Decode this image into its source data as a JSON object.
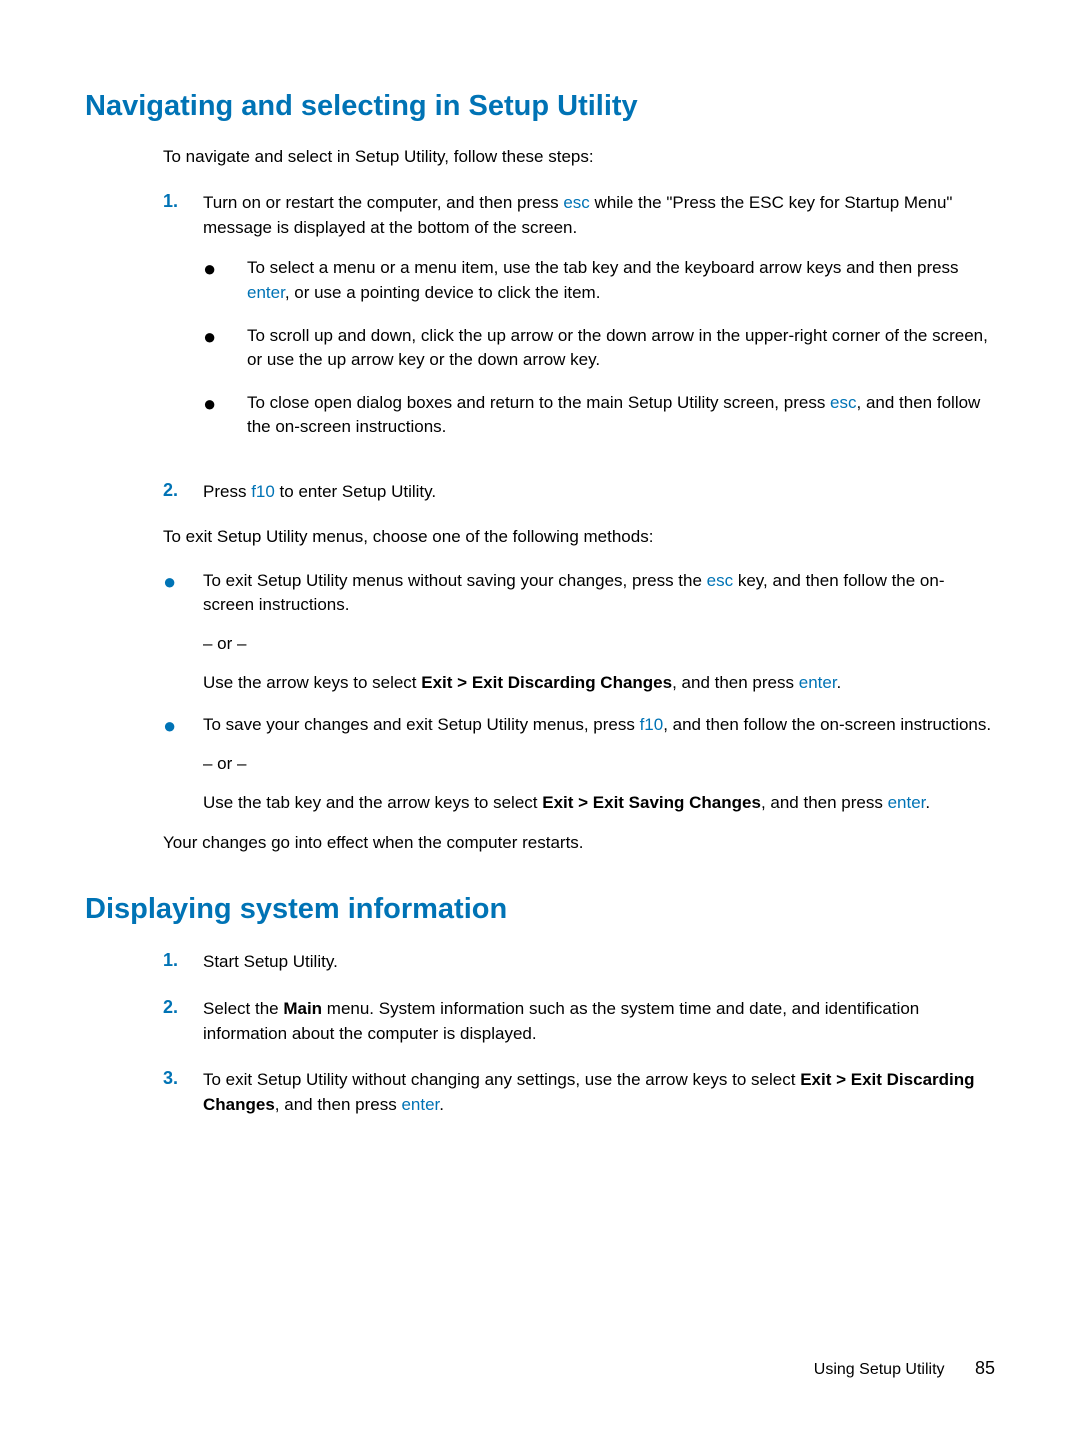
{
  "section1": {
    "heading": "Navigating and selecting in Setup Utility",
    "intro": "To navigate and select in Setup Utility, follow these steps:",
    "step1_num": "1.",
    "step1_a": "Turn on or restart the computer, and then press ",
    "step1_key1": "esc",
    "step1_b": " while the \"Press the ESC key for Startup Menu\" message is displayed at the bottom of the screen.",
    "sub1_a": "To select a menu or a menu item, use the tab key and the keyboard arrow keys and then press ",
    "sub1_key": "enter",
    "sub1_b": ", or use a pointing device to click the item.",
    "sub2": "To scroll up and down, click the up arrow or the down arrow in the upper-right corner of the screen, or use the up arrow key or the down arrow key.",
    "sub3_a": "To close open dialog boxes and return to the main Setup Utility screen, press ",
    "sub3_key": "esc",
    "sub3_b": ", and then follow the on-screen instructions.",
    "step2_num": "2.",
    "step2_a": "Press ",
    "step2_key": "f10",
    "step2_b": " to enter Setup Utility.",
    "exit_intro": "To exit Setup Utility menus, choose one of the following methods:",
    "exit1_a": "To exit Setup Utility menus without saving your changes, press the ",
    "exit1_key": "esc",
    "exit1_b": " key, and then follow the on-screen instructions.",
    "or": "– or –",
    "exit1_c": "Use the arrow keys to select ",
    "exit1_bold": "Exit > Exit Discarding Changes",
    "exit1_d": ", and then press ",
    "exit1_key2": "enter",
    "exit1_e": ".",
    "exit2_a": "To save your changes and exit Setup Utility menus, press ",
    "exit2_key": "f10",
    "exit2_b": ", and then follow the on-screen instructions.",
    "exit2_c": "Use the tab key and the arrow keys to select ",
    "exit2_bold": "Exit > Exit Saving Changes",
    "exit2_d": ", and then press ",
    "exit2_key2": "enter",
    "exit2_e": ".",
    "final": "Your changes go into effect when the computer restarts."
  },
  "section2": {
    "heading": "Displaying system information",
    "step1_num": "1.",
    "step1": "Start Setup Utility.",
    "step2_num": "2.",
    "step2_a": "Select the ",
    "step2_bold": "Main",
    "step2_b": " menu. System information such as the system time and date, and identification information about the computer is displayed.",
    "step3_num": "3.",
    "step3_a": "To exit Setup Utility without changing any settings, use the arrow keys to select ",
    "step3_bold": "Exit > Exit Discarding Changes",
    "step3_b": ", and then press ",
    "step3_key": "enter",
    "step3_c": "."
  },
  "footer": {
    "text": "Using Setup Utility",
    "page": "85"
  }
}
